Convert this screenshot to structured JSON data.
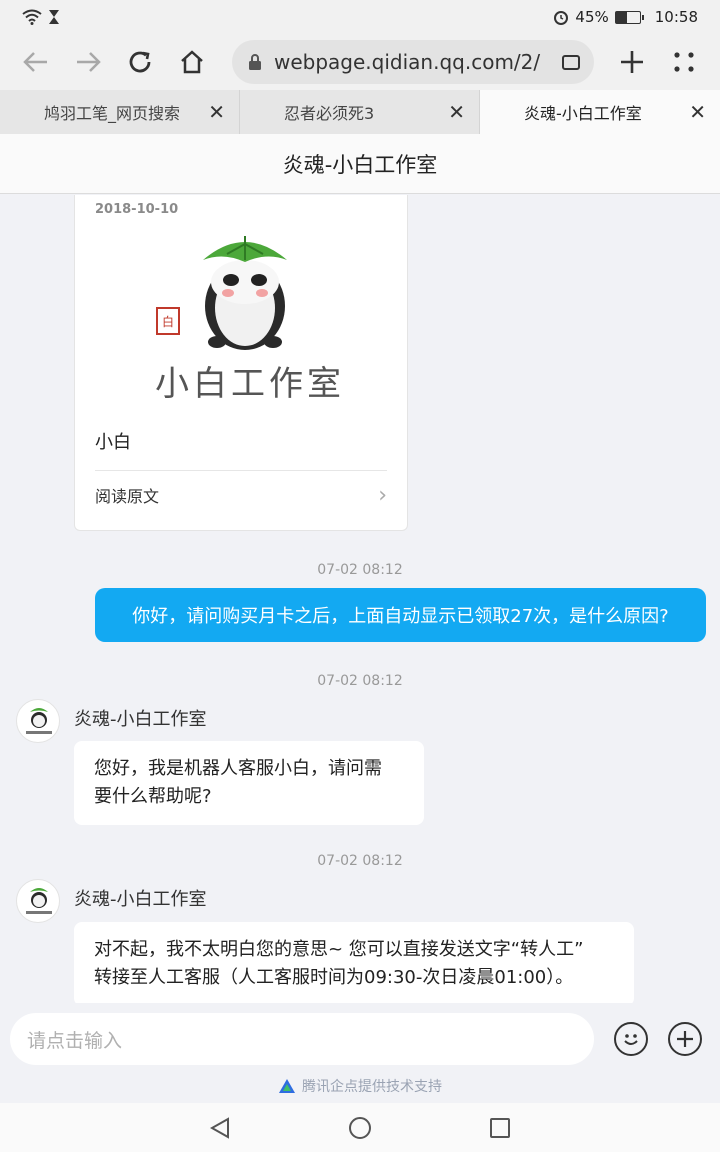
{
  "status_bar": {
    "battery_percent": "45%",
    "battery_level": 0.45,
    "time": "10:58"
  },
  "browser": {
    "url": "webpage.qidian.qq.com/2/",
    "tabs": [
      {
        "title": "鸠羽工笔_网页搜索",
        "active": false
      },
      {
        "title": "忍者必须死3",
        "active": false
      },
      {
        "title": "炎魂-小白工作室",
        "active": true
      }
    ]
  },
  "page": {
    "title": "炎魂-小白工作室"
  },
  "card": {
    "date": "2018-10-10",
    "brand_text": "小白工作室",
    "title": "小白",
    "link_label": "阅读原文"
  },
  "messages": [
    {
      "timestamp": "07-02 08:12",
      "direction": "out",
      "text": "你好，请问购买月卡之后，上面自动显示已领取27次，是什么原因?"
    },
    {
      "timestamp": "07-02 08:12",
      "direction": "in",
      "sender": "炎魂-小白工作室",
      "lines": [
        "您好，我是机器人客服小白，请问需",
        "要什么帮助呢?"
      ]
    },
    {
      "timestamp": "07-02 08:12",
      "direction": "in",
      "sender": "炎魂-小白工作室",
      "lines": [
        "对不起，我不太明白您的意思~ 您可以直接发送文字“转人工”",
        "转接至人工客服（人工客服时间为09:30-次日凌晨01:00）。"
      ]
    }
  ],
  "input": {
    "placeholder": "请点击输入"
  },
  "footer": {
    "note": "腾讯企点提供技术支持"
  },
  "colors": {
    "outgoing_bubble": "#13a9f2",
    "chat_background": "#f1f2f6"
  }
}
